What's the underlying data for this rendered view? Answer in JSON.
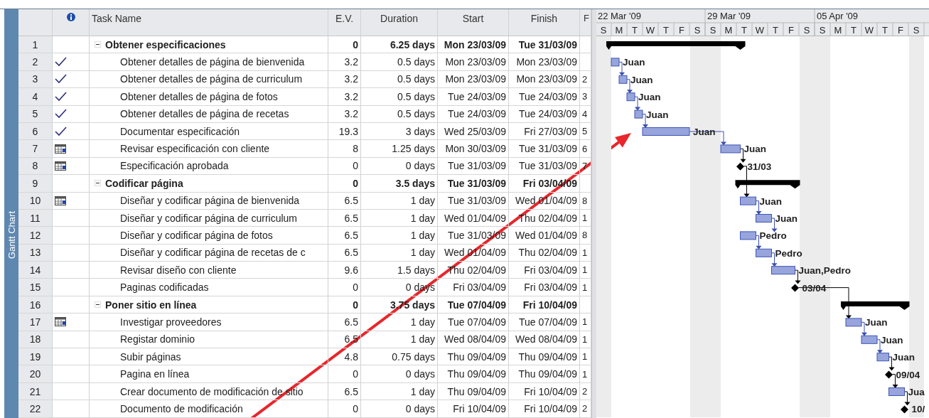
{
  "side_tab": {
    "label": "Gantt Chart"
  },
  "table": {
    "columns": [
      "Task Name",
      "E.V.",
      "Duration",
      "Start",
      "Finish",
      "F"
    ],
    "rows": [
      {
        "id": "1",
        "kind": "summary",
        "completed": false,
        "calendar": false,
        "expanded": true,
        "name": "Obtener especificaciones",
        "ev": "0",
        "duration": "6.25 days",
        "start": "Mon 23/03/09",
        "finish": "Tue 31/03/09"
      },
      {
        "id": "2",
        "kind": "task",
        "completed": true,
        "calendar": false,
        "name": "Obtener detalles de página de bienvenida",
        "ev": "3.2",
        "duration": "0.5 days",
        "start": "Mon 23/03/09",
        "finish": "Mon 23/03/09",
        "bar_label": "Juan"
      },
      {
        "id": "3",
        "kind": "task",
        "completed": true,
        "calendar": false,
        "name": "Obtener detalles de página de curriculum",
        "ev": "3.2",
        "duration": "0.5 days",
        "start": "Mon 23/03/09",
        "finish": "Mon 23/03/09",
        "predecessors": "2",
        "bar_label": "Juan"
      },
      {
        "id": "4",
        "kind": "task",
        "completed": true,
        "calendar": false,
        "name": "Obtener detalles de página de fotos",
        "ev": "3.2",
        "duration": "0.5 days",
        "start": "Tue 24/03/09",
        "finish": "Tue 24/03/09",
        "predecessors": "3",
        "bar_label": "Juan"
      },
      {
        "id": "5",
        "kind": "task",
        "completed": true,
        "calendar": false,
        "name": "Obtener detalles de página de recetas",
        "ev": "3.2",
        "duration": "0.5 days",
        "start": "Tue 24/03/09",
        "finish": "Tue 24/03/09",
        "predecessors": "4",
        "bar_label": "Juan"
      },
      {
        "id": "6",
        "kind": "task",
        "completed": true,
        "calendar": false,
        "name": "Documentar especificación",
        "ev": "19.3",
        "duration": "3 days",
        "start": "Wed 25/03/09",
        "finish": "Fri 27/03/09",
        "predecessors": "5",
        "bar_label": "Juan"
      },
      {
        "id": "7",
        "kind": "task",
        "completed": false,
        "calendar": true,
        "name": "Revisar especificación con cliente",
        "ev": "8",
        "duration": "1.25 days",
        "start": "Mon 30/03/09",
        "finish": "Tue 31/03/09",
        "predecessors": "6",
        "bar_label": "Juan"
      },
      {
        "id": "8",
        "kind": "milestone",
        "completed": false,
        "calendar": true,
        "name": "Especificación aprobada",
        "ev": "0",
        "duration": "0 days",
        "start": "Tue 31/03/09",
        "finish": "Tue 31/03/09",
        "predecessors": "7",
        "bar_label": "31/03"
      },
      {
        "id": "9",
        "kind": "summary",
        "completed": false,
        "calendar": false,
        "expanded": true,
        "name": "Codificar página",
        "ev": "0",
        "duration": "3.5 days",
        "start": "Tue 31/03/09",
        "finish": "Fri 03/04/09"
      },
      {
        "id": "10",
        "kind": "task",
        "completed": false,
        "calendar": true,
        "name": "Diseñar y codificar página de bienvenida",
        "ev": "6.5",
        "duration": "1 day",
        "start": "Tue 31/03/09",
        "finish": "Wed 01/04/09",
        "predecessors": "8",
        "bar_label": "Juan"
      },
      {
        "id": "11",
        "kind": "task",
        "completed": false,
        "calendar": false,
        "name": "Diseñar y codificar página de curriculum",
        "ev": "6.5",
        "duration": "1 day",
        "start": "Wed 01/04/09",
        "finish": "Thu 02/04/09",
        "predecessors": "1",
        "bar_label": "Juan"
      },
      {
        "id": "12",
        "kind": "task",
        "completed": false,
        "calendar": false,
        "name": "Diseñar y codificar página de fotos",
        "ev": "6.5",
        "duration": "1 day",
        "start": "Tue 31/03/09",
        "finish": "Wed 01/04/09",
        "predecessors": "8",
        "bar_label": "Pedro"
      },
      {
        "id": "13",
        "kind": "task",
        "completed": false,
        "calendar": false,
        "name": "Diseñar y codificar página de recetas de c",
        "ev": "6.5",
        "duration": "1 day",
        "start": "Wed 01/04/09",
        "finish": "Thu 02/04/09",
        "predecessors": "1",
        "bar_label": "Pedro"
      },
      {
        "id": "14",
        "kind": "task",
        "completed": false,
        "calendar": false,
        "name": "Revisar diseño con cliente",
        "ev": "9.6",
        "duration": "1.5 days",
        "start": "Thu 02/04/09",
        "finish": "Fri 03/04/09",
        "predecessors": "1",
        "bar_label": "Juan,Pedro"
      },
      {
        "id": "15",
        "kind": "milestone",
        "completed": false,
        "calendar": false,
        "name": "Paginas codificadas",
        "ev": "0",
        "duration": "0 days",
        "start": "Fri 03/04/09",
        "finish": "Fri 03/04/09",
        "predecessors": "1",
        "bar_label": "03/04"
      },
      {
        "id": "16",
        "kind": "summary",
        "completed": false,
        "calendar": false,
        "expanded": true,
        "name": "Poner sitio en línea",
        "ev": "0",
        "duration": "3.75 days",
        "start": "Tue 07/04/09",
        "finish": "Fri 10/04/09"
      },
      {
        "id": "17",
        "kind": "task",
        "completed": false,
        "calendar": true,
        "name": "Investigar proveedores",
        "ev": "6.5",
        "duration": "1 day",
        "start": "Tue 07/04/09",
        "finish": "Tue 07/04/09",
        "predecessors": "1",
        "bar_label": "Juan"
      },
      {
        "id": "18",
        "kind": "task",
        "completed": false,
        "calendar": false,
        "name": "Registar dominio",
        "ev": "6.5",
        "duration": "1 day",
        "start": "Wed 08/04/09",
        "finish": "Wed 08/04/09",
        "predecessors": "1",
        "bar_label": "Juan"
      },
      {
        "id": "19",
        "kind": "task",
        "completed": false,
        "calendar": false,
        "name": "Subir páginas",
        "ev": "4.8",
        "duration": "0.75 days",
        "start": "Thu 09/04/09",
        "finish": "Thu 09/04/09",
        "predecessors": "1",
        "bar_label": "Juan"
      },
      {
        "id": "20",
        "kind": "milestone",
        "completed": false,
        "calendar": false,
        "name": "Pagina en línea",
        "ev": "0",
        "duration": "0 days",
        "start": "Thu 09/04/09",
        "finish": "Thu 09/04/09",
        "predecessors": "1",
        "bar_label": "09/04"
      },
      {
        "id": "21",
        "kind": "task",
        "completed": false,
        "calendar": false,
        "name": "Crear documento de modificación de sitio",
        "ev": "6.5",
        "duration": "1 day",
        "start": "Thu 09/04/09",
        "finish": "Fri 10/04/09",
        "predecessors": "2",
        "bar_label": "Jua"
      },
      {
        "id": "22",
        "kind": "milestone",
        "completed": false,
        "calendar": false,
        "name": "Documento de modificación",
        "ev": "0",
        "duration": "0 days",
        "start": "Fri 10/04/09",
        "finish": "Fri 10/04/09",
        "predecessors": "2",
        "bar_label": "10/"
      }
    ]
  },
  "timescale": {
    "weeks": [
      "22 Mar '09",
      "29 Mar '09",
      "05 Apr '09"
    ],
    "days": [
      "S",
      "M",
      "T",
      "W",
      "T",
      "F",
      "S",
      "S",
      "M",
      "T",
      "W",
      "T",
      "F",
      "S",
      "S",
      "M",
      "T",
      "W",
      "T",
      "F",
      "S"
    ]
  }
}
